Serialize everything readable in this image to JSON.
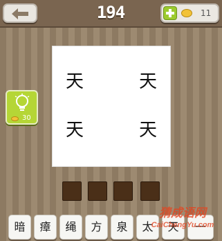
{
  "header": {
    "back_icon": "arrow-left-icon",
    "level_number": "194",
    "add_coins_icon": "plus-icon",
    "coin_icon": "coin-icon",
    "coins": "11"
  },
  "puzzle": {
    "chars": [
      "天",
      "天",
      "天",
      "天"
    ]
  },
  "hint": {
    "icon": "lightbulb-icon",
    "cost": "30"
  },
  "answer": {
    "slots": [
      "",
      "",
      "",
      ""
    ]
  },
  "tiles": [
    "暗",
    "瘴",
    "绳",
    "方",
    "泉",
    "太",
    "天",
    "一"
  ],
  "watermark": {
    "title": "猜成语网",
    "url": "CaiChengYu.com"
  },
  "colors": {
    "background": "#8d7a62",
    "topbar": "#7a6550",
    "hint_green": "#b5d636",
    "add_green": "#9ccb2e",
    "slot": "#4a2f18",
    "coin": "#f2c238"
  }
}
